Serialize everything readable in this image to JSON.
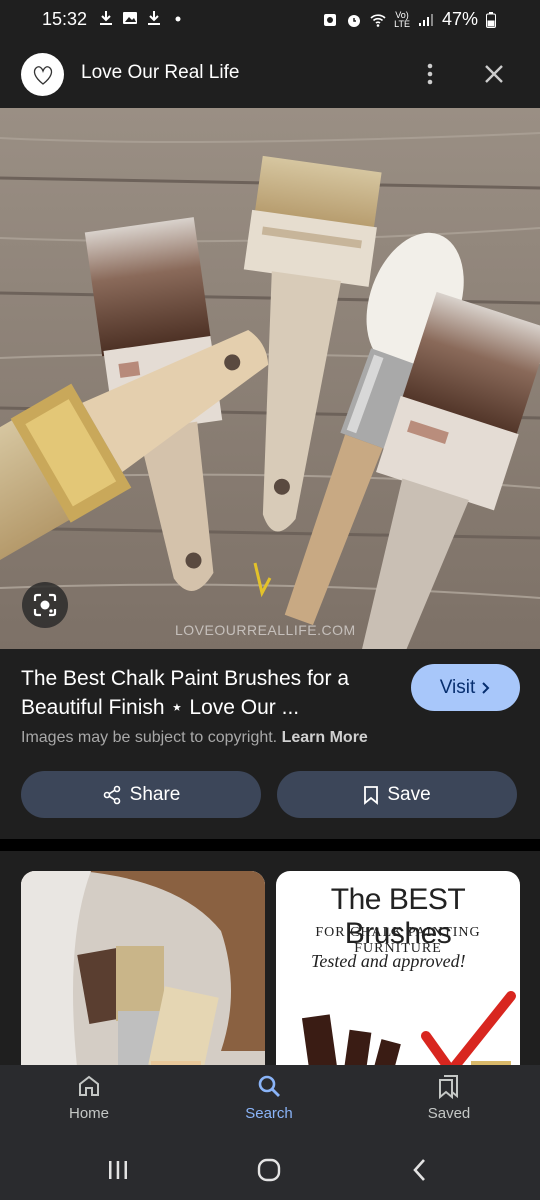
{
  "status_bar": {
    "time": "15:32",
    "battery": "47%",
    "network": "LTE"
  },
  "header": {
    "site_name": "Love Our Real Life",
    "logo_icon": "heart-outline-icon",
    "more_icon": "more-vert-icon",
    "close_icon": "close-icon"
  },
  "image": {
    "watermark": "LOVEOURREALLIFE.COM",
    "lens_icon": "google-lens-icon"
  },
  "result": {
    "title": "The Best Chalk Paint Brushes for a Beautiful Finish ⋆ Love Our ...",
    "visit_label": "Visit",
    "copyright_text": "Images may be subject to copyright.",
    "learn_more": "Learn More",
    "share_label": "Share",
    "save_label": "Save"
  },
  "related": {
    "card2_title": "The BEST Brushes",
    "card2_subtitle": "FOR CHALK PAINTING FURNITURE",
    "card2_tagline": "Tested and approved!"
  },
  "bottom_nav": {
    "items": [
      {
        "label": "Home",
        "icon": "home-icon",
        "active": false
      },
      {
        "label": "Search",
        "icon": "search-icon",
        "active": true
      },
      {
        "label": "Saved",
        "icon": "bookmarks-icon",
        "active": false
      }
    ]
  },
  "colors": {
    "background": "#1f1f1f",
    "accent": "#8ab4f8",
    "visit_button": "#a8c7fa",
    "action_button": "#3c4659"
  }
}
